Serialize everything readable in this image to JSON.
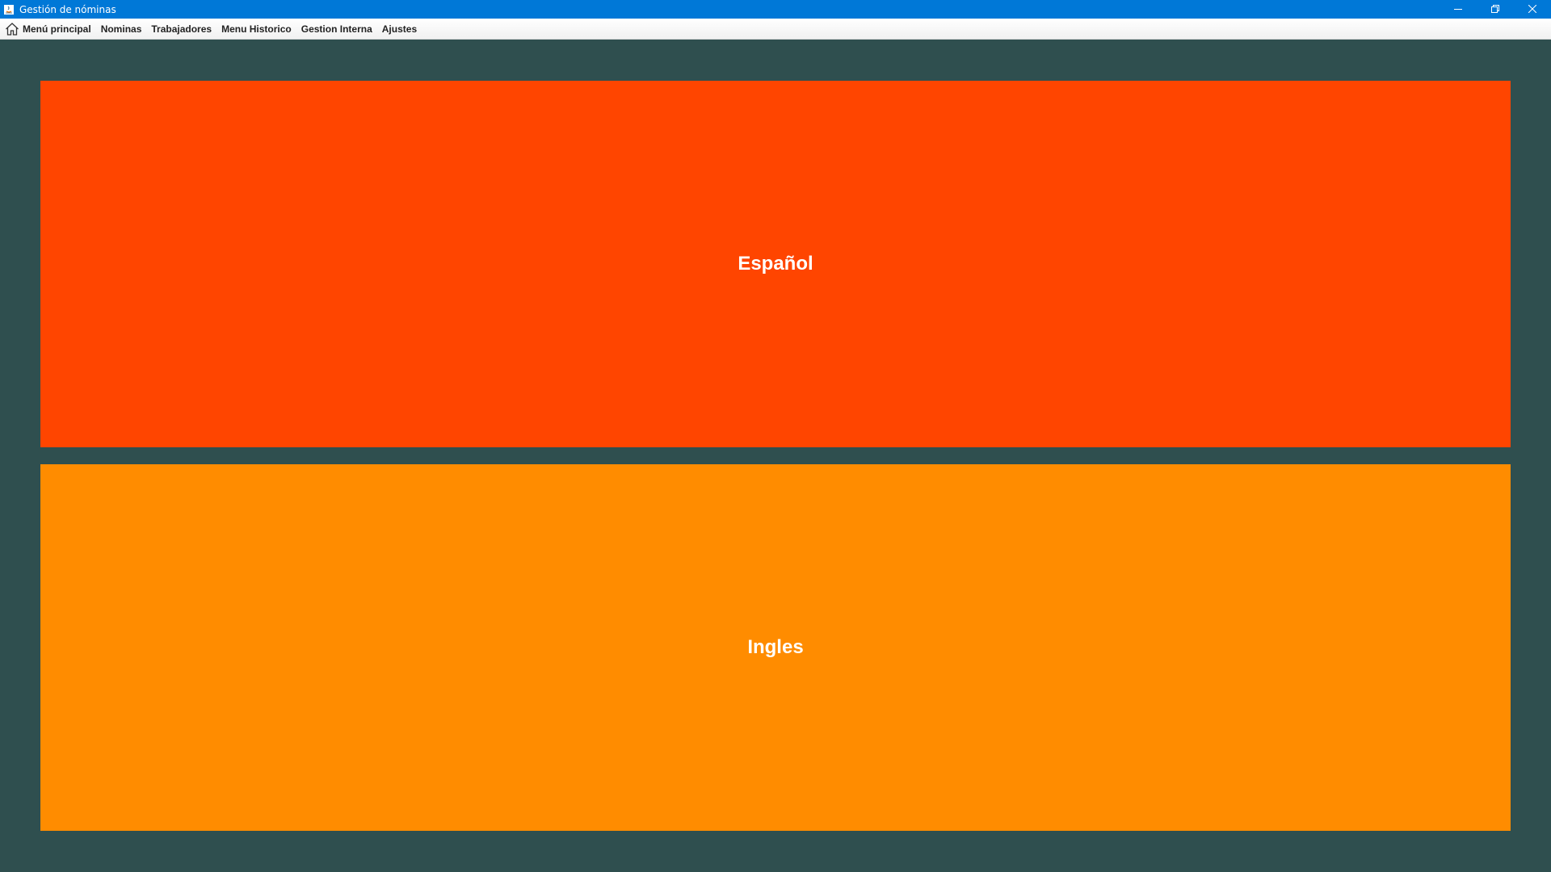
{
  "window": {
    "title": "Gestión de nóminas",
    "icons": [
      "java-app-icon",
      "minimize-icon",
      "restore-icon",
      "close-icon"
    ]
  },
  "menu": {
    "items": [
      {
        "label": "Menú principal",
        "icon": "home-icon"
      },
      {
        "label": "Nominas"
      },
      {
        "label": "Trabajadores"
      },
      {
        "label": "Menu Historico"
      },
      {
        "label": "Gestion Interna"
      },
      {
        "label": "Ajustes"
      }
    ]
  },
  "languages": {
    "spanish": {
      "label": "Español",
      "color": "#ff4500"
    },
    "english": {
      "label": "Ingles",
      "color": "#ff8c00"
    }
  },
  "colors": {
    "titlebar": "#0078d7",
    "background": "#2f4f4f"
  }
}
